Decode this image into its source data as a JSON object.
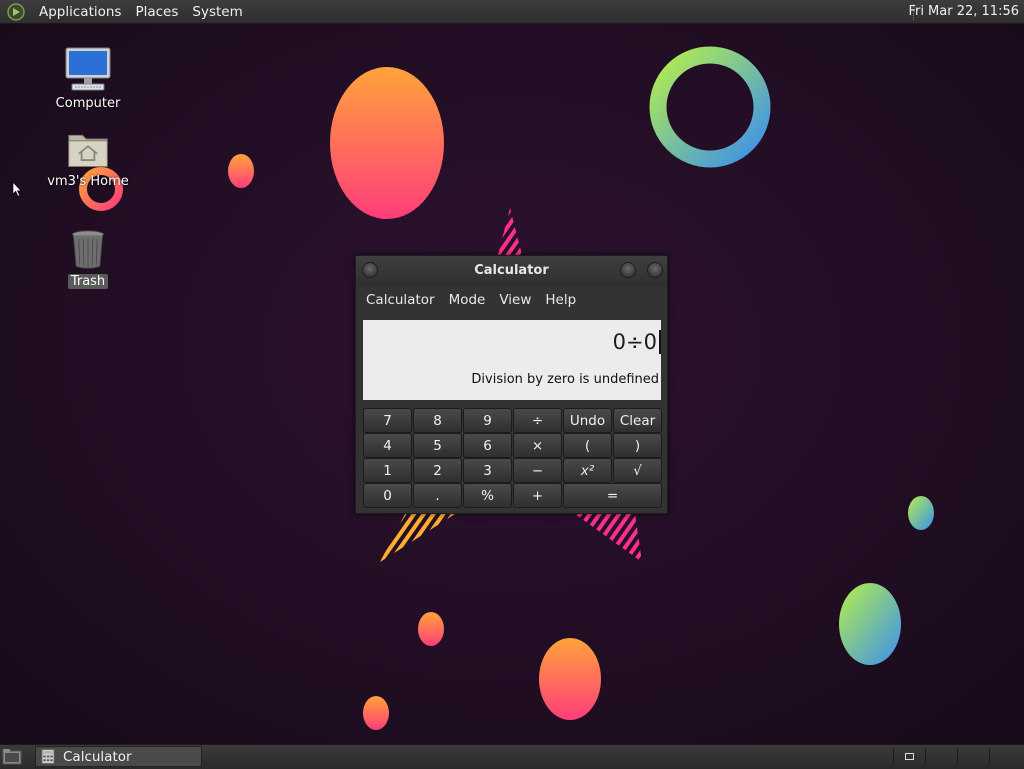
{
  "top_panel": {
    "menus": [
      "Applications",
      "Places",
      "System"
    ],
    "clock": "Fri Mar 22, 11:56"
  },
  "desktop": {
    "icons": [
      {
        "label": "Computer",
        "icon": "computer-icon"
      },
      {
        "label": "vm3's Home",
        "icon": "home-folder-icon"
      },
      {
        "label": "Trash",
        "icon": "trash-icon",
        "selected": true
      }
    ]
  },
  "calculator": {
    "title": "Calculator",
    "menus": [
      "Calculator",
      "Mode",
      "View",
      "Help"
    ],
    "expression": "0÷0",
    "result": "Division by zero is undefined",
    "keys": [
      [
        "7",
        "8",
        "9",
        "÷",
        "Undo",
        "Clear"
      ],
      [
        "4",
        "5",
        "6",
        "×",
        "(",
        ")"
      ],
      [
        "1",
        "2",
        "3",
        "−",
        "x²",
        "√"
      ],
      [
        "0",
        ".",
        "%",
        "+",
        "="
      ]
    ]
  },
  "taskbar": {
    "items": [
      {
        "label": "Calculator",
        "icon": "calculator-icon"
      }
    ]
  },
  "colors": {
    "panel": "#2e2e2e",
    "wallpaper": "#1f0f22",
    "display_bg": "#ececec"
  }
}
